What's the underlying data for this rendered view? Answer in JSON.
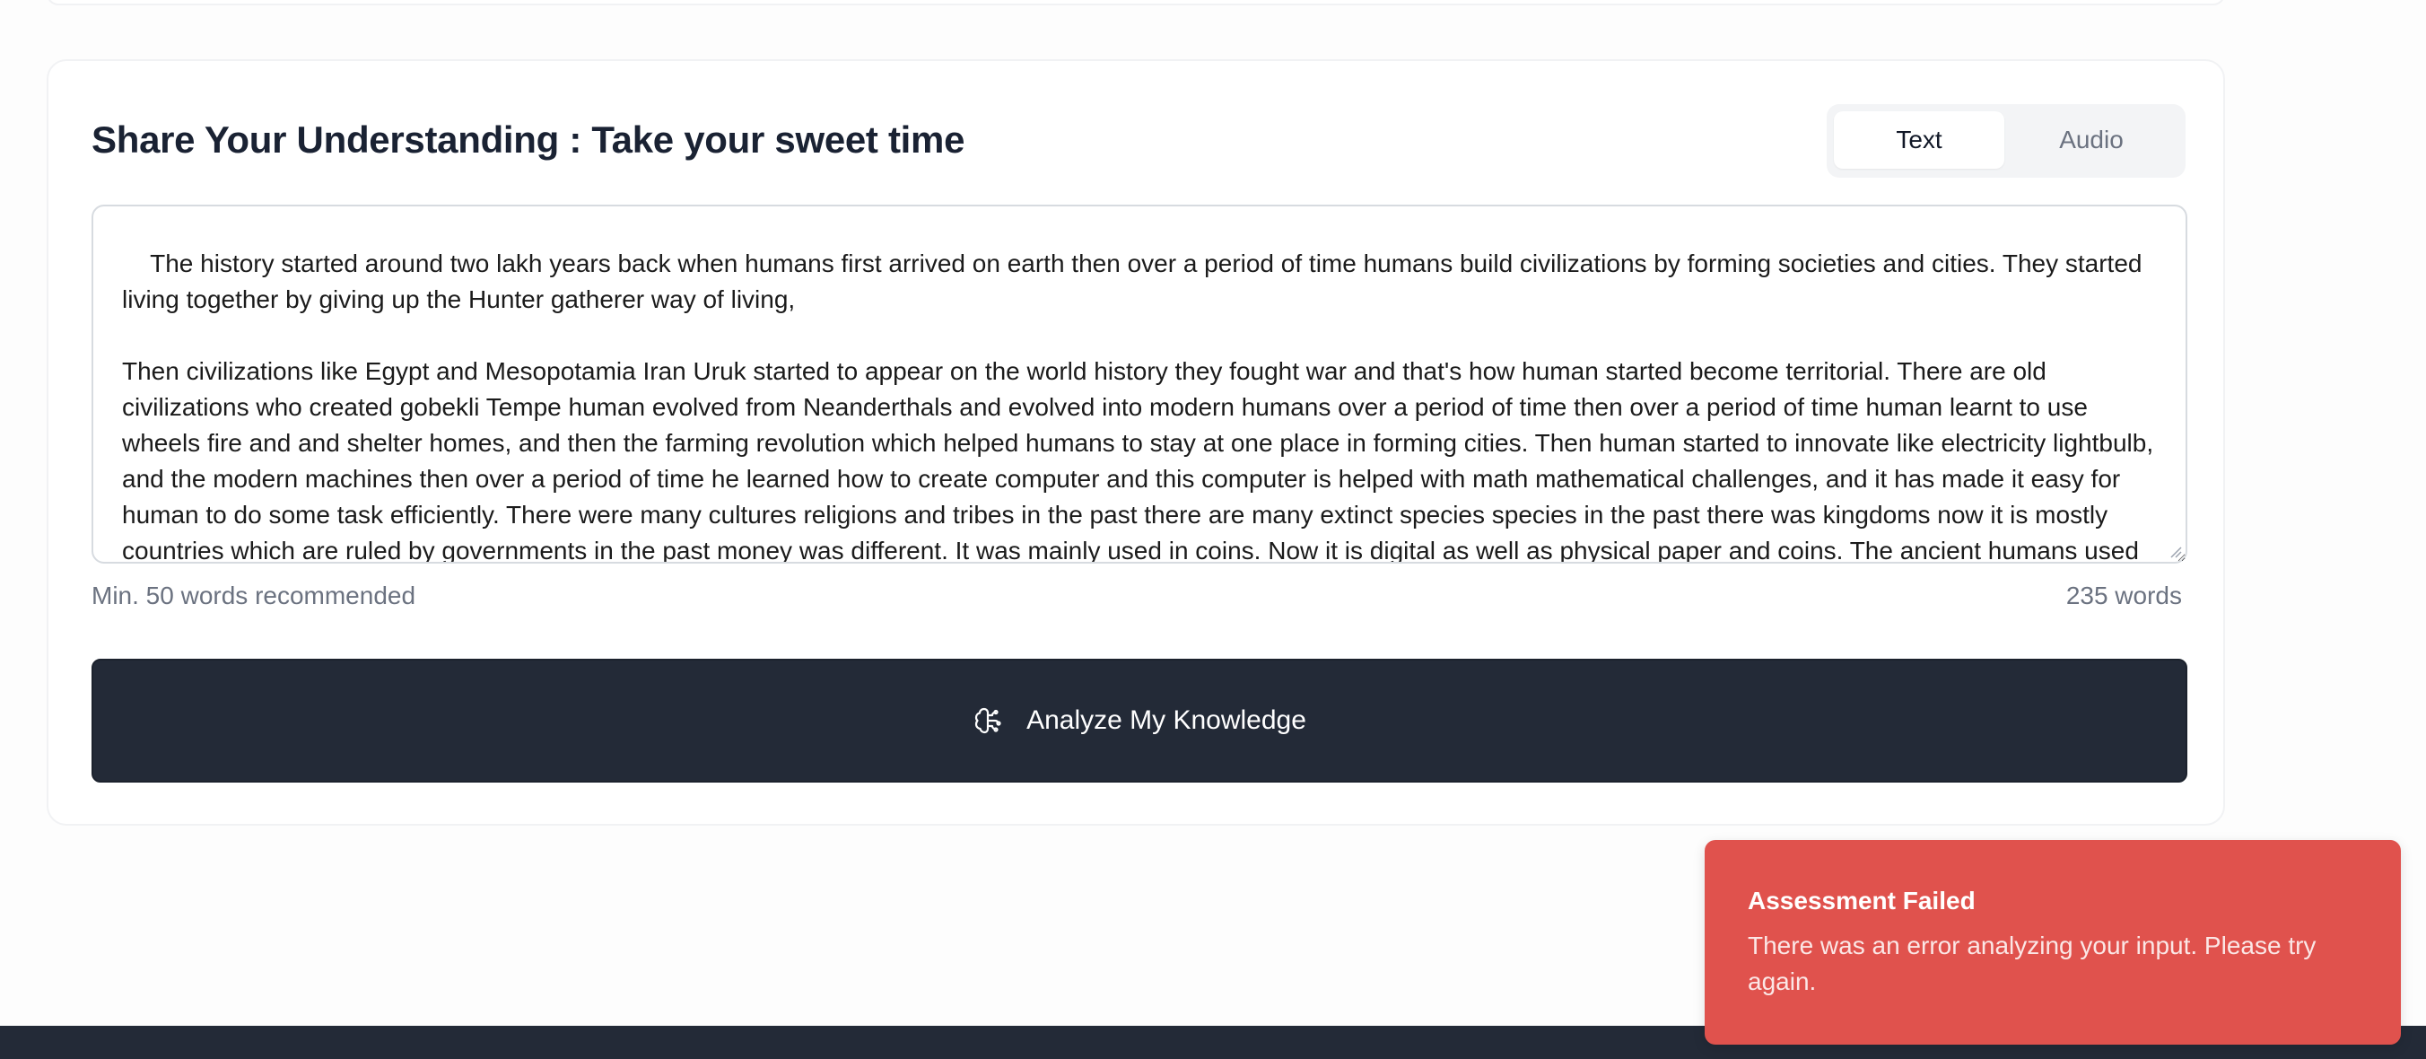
{
  "section": {
    "title": "Share Your Understanding : Take your sweet time",
    "tabs": {
      "text": "Text",
      "audio": "Audio",
      "active": "Text"
    }
  },
  "response": {
    "text": "The history started around two lakh years back when humans first arrived on earth then over a period of time humans build civilizations by forming societies and cities. They started living together by giving up the Hunter gatherer way of living,\n\nThen civilizations like Egypt and Mesopotamia Iran Uruk started to appear on the world history they fought war and that's how human started become territorial. There are old civilizations who created gobekli Tempe human evolved from Neanderthals and evolved into modern humans over a period of time then over a period of time human learnt to use wheels fire and and shelter homes, and then the farming revolution which helped humans to stay at one place in forming cities. Then human started to innovate like electricity lightbulb, and the modern machines then over a period of time he learned how to create computer and this computer is helped with math mathematical challenges, and it has made it easy for human to do some task efficiently. There were many cultures religions and tribes in the past there are many extinct species species in the past there was kingdoms now it is mostly countries which are ruled by governments in the past money was different. It was mainly used in coins. Now it is digital as well as physical paper and coins. The ancient humans used butter system to exchange and trade different goods within them.",
    "hint": "Min. 50 words recommended",
    "word_count": "235 words"
  },
  "actions": {
    "analyze_label": "Analyze My Knowledge",
    "analyze_icon": "brain-icon"
  },
  "toast": {
    "title": "Assessment Failed",
    "message": "There was an error analyzing your input. Please try again.",
    "color": "#e0524d"
  },
  "colors": {
    "primary_dark": "#232a37",
    "error": "#e0524d"
  }
}
